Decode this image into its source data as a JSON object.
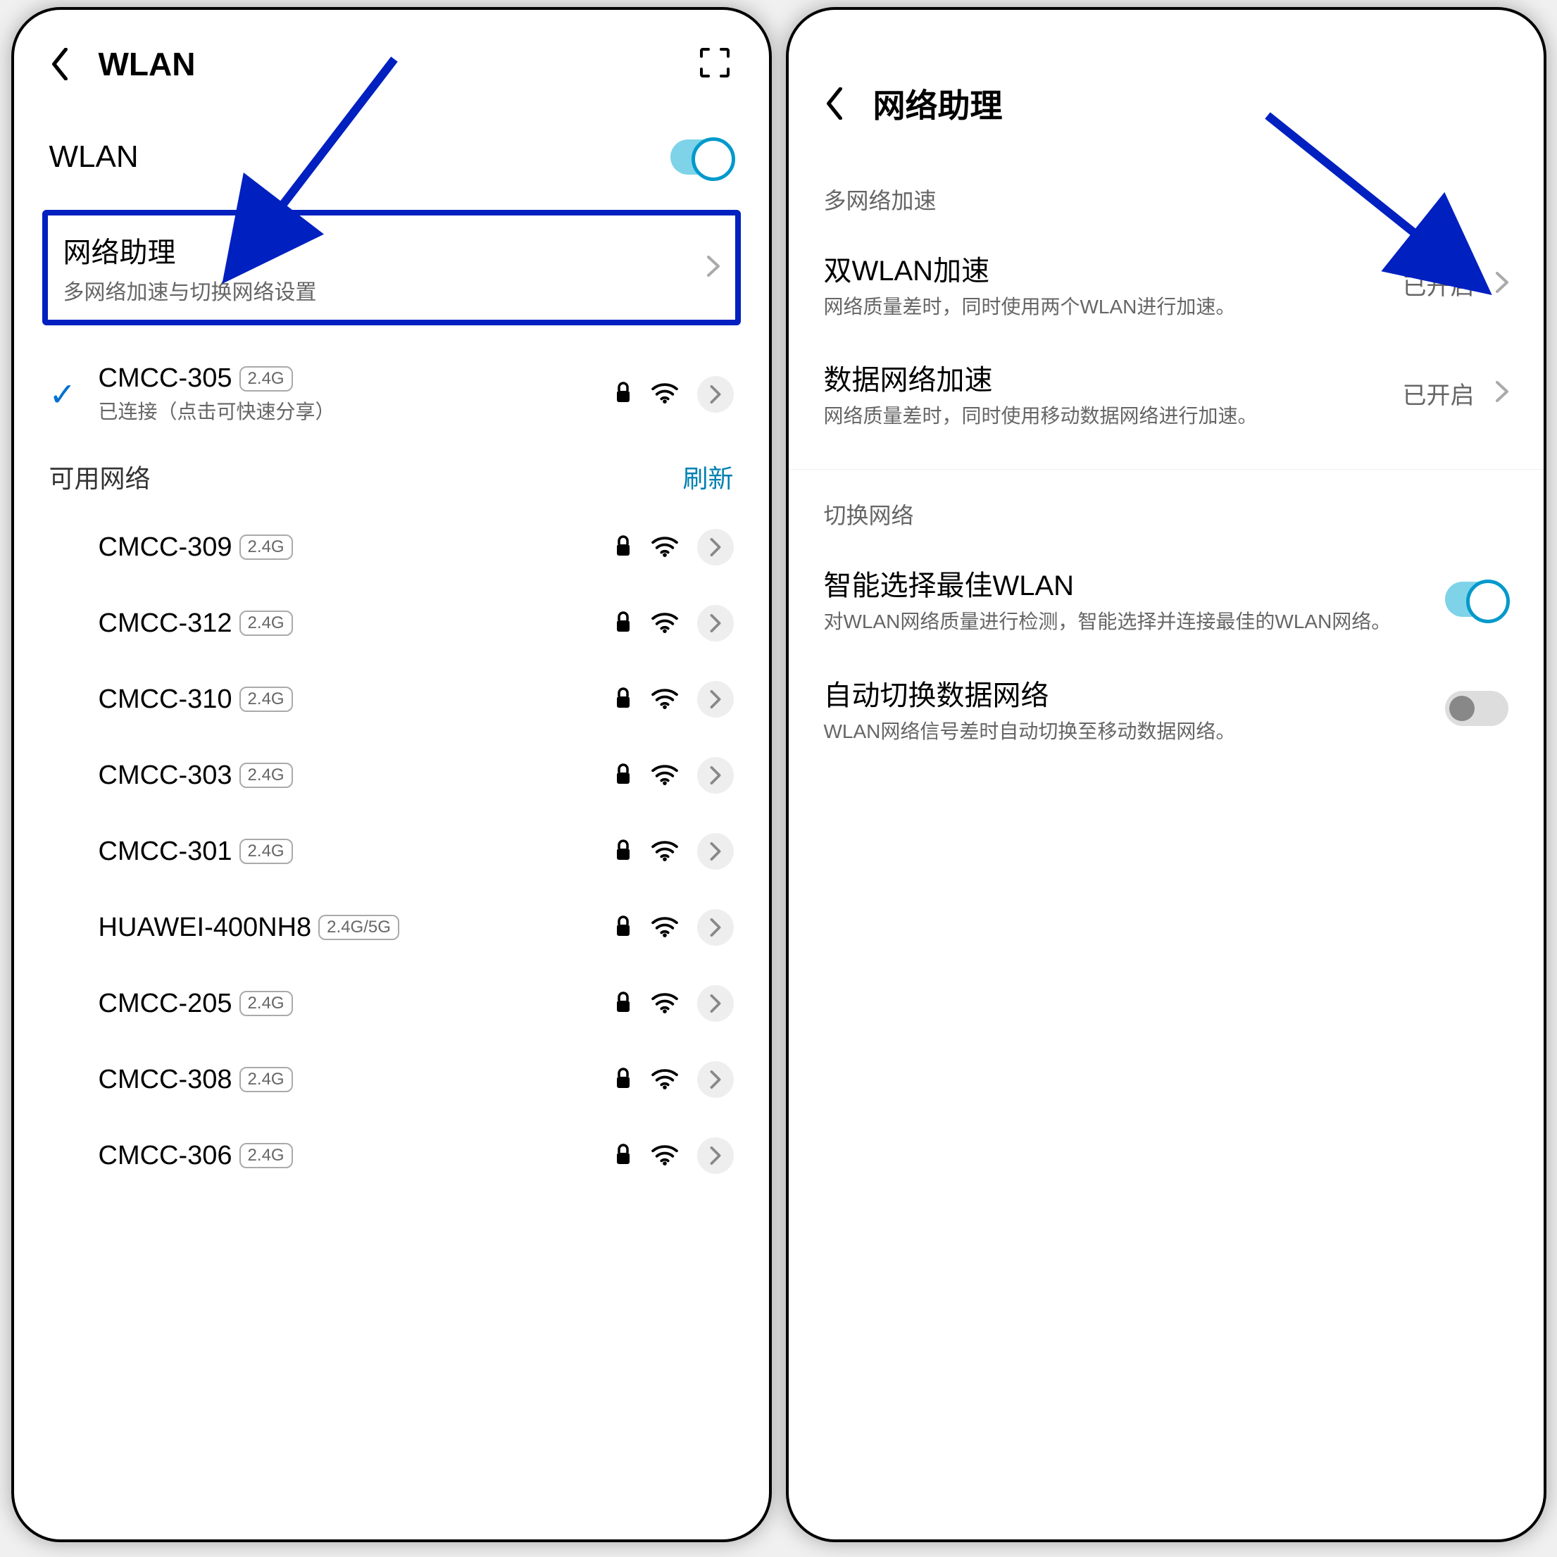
{
  "screen1": {
    "header_title": "WLAN",
    "wlan_label": "WLAN",
    "assistant": {
      "title": "网络助理",
      "subtitle": "多网络加速与切换网络设置"
    },
    "connected": {
      "ssid": "CMCC-305",
      "band": "2.4G",
      "status": "已连接（点击可快速分享）"
    },
    "available_label": "可用网络",
    "refresh_label": "刷新",
    "networks": [
      {
        "ssid": "CMCC-309",
        "band": "2.4G"
      },
      {
        "ssid": "CMCC-312",
        "band": "2.4G"
      },
      {
        "ssid": "CMCC-310",
        "band": "2.4G"
      },
      {
        "ssid": "CMCC-303",
        "band": "2.4G"
      },
      {
        "ssid": "CMCC-301",
        "band": "2.4G"
      },
      {
        "ssid": "HUAWEI-400NH8",
        "band": "2.4G/5G"
      },
      {
        "ssid": "CMCC-205",
        "band": "2.4G"
      },
      {
        "ssid": "CMCC-308",
        "band": "2.4G"
      },
      {
        "ssid": "CMCC-306",
        "band": "2.4G"
      }
    ]
  },
  "screen2": {
    "header_title": "网络助理",
    "section_accel": "多网络加速",
    "dual_wlan": {
      "title": "双WLAN加速",
      "subtitle": "网络质量差时，同时使用两个WLAN进行加速。",
      "value": "已开启"
    },
    "data_accel": {
      "title": "数据网络加速",
      "subtitle": "网络质量差时，同时使用移动数据网络进行加速。",
      "value": "已开启"
    },
    "section_switch": "切换网络",
    "smart_wlan": {
      "title": "智能选择最佳WLAN",
      "subtitle": "对WLAN网络质量进行检测，智能选择并连接最佳的WLAN网络。"
    },
    "auto_switch": {
      "title": "自动切换数据网络",
      "subtitle": "WLAN网络信号差时自动切换至移动数据网络。"
    }
  }
}
